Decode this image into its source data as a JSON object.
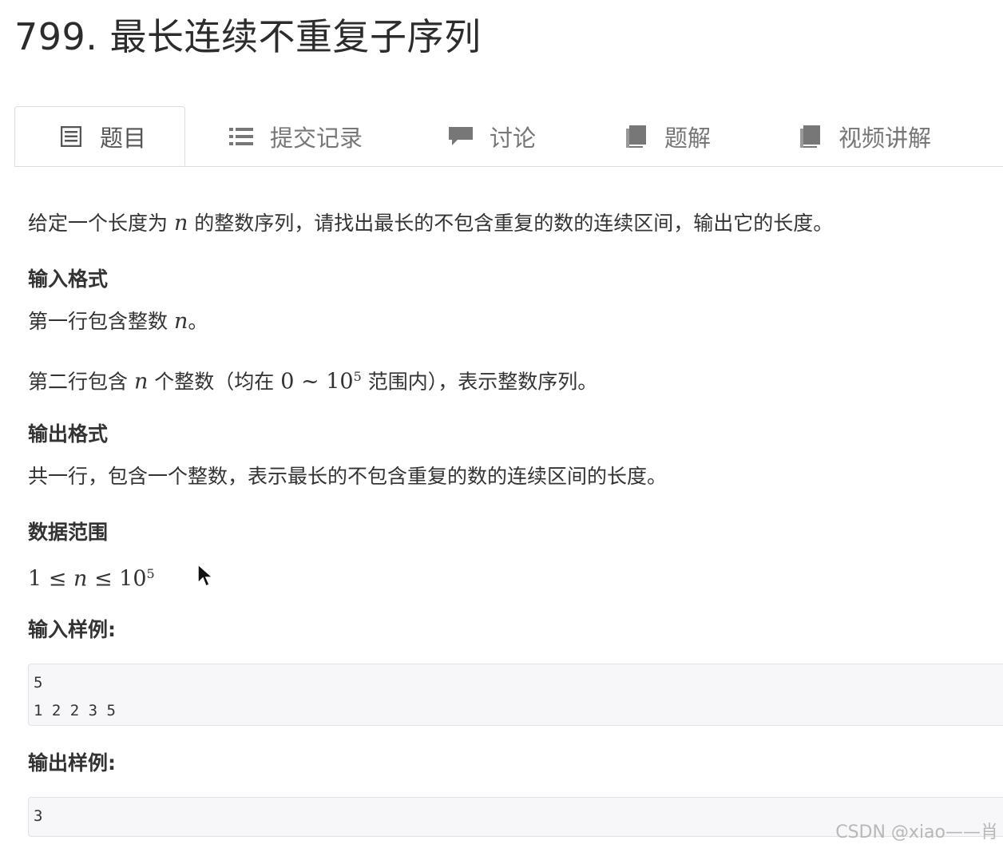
{
  "title": "799. 最长连续不重复子序列",
  "tabs": [
    {
      "label": "题目",
      "icon": "list-doc-icon",
      "active": true
    },
    {
      "label": "提交记录",
      "icon": "list-bullets-icon",
      "active": false
    },
    {
      "label": "讨论",
      "icon": "comment-icon",
      "active": false
    },
    {
      "label": "题解",
      "icon": "book-icon",
      "active": false
    },
    {
      "label": "视频讲解",
      "icon": "book-icon",
      "active": false
    }
  ],
  "description": {
    "part1": "给定一个长度为 ",
    "var_n": "n",
    "part2": " 的整数序列，请找出最长的不包含重复的数的连续区间，输出它的长度。"
  },
  "input_format": {
    "heading": "输入格式",
    "line1_a": "第一行包含整数 ",
    "line1_var": "n",
    "line1_b": "。",
    "line2_a": "第二行包含 ",
    "line2_var": "n",
    "line2_b": " 个整数（均在 ",
    "line2_zero": "0",
    "line2_tilde": " ∼ ",
    "line2_ten": "10",
    "line2_exp": "5",
    "line2_c": " 范围内），表示整数序列。"
  },
  "output_format": {
    "heading": "输出格式",
    "line1": "共一行，包含一个整数，表示最长的不包含重复的数的连续区间的长度。"
  },
  "data_range": {
    "heading": "数据范围",
    "one": "1",
    "le1": " ≤ ",
    "var": "n",
    "le2": " ≤ ",
    "ten": "10",
    "exp": "5"
  },
  "sample_input": {
    "heading": "输入样例:",
    "code": "5\n1 2 2 3 5"
  },
  "sample_output": {
    "heading": "输出样例:",
    "code": "3"
  },
  "watermark": "CSDN @xiao——肖"
}
